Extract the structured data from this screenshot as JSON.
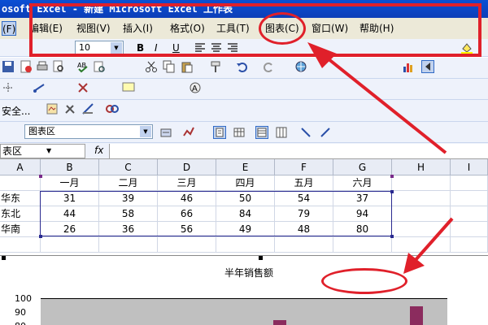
{
  "window": {
    "title": "osoft Excel - 新建 Microsoft Excel 工作表"
  },
  "menu": {
    "items": [
      {
        "label": "(F)",
        "name": "menu-file"
      },
      {
        "label": "编辑(E)",
        "name": "menu-edit"
      },
      {
        "label": "视图(V)",
        "name": "menu-view"
      },
      {
        "label": "插入(I)",
        "name": "menu-insert"
      },
      {
        "label": "格式(O)",
        "name": "menu-format"
      },
      {
        "label": "工具(T)",
        "name": "menu-tools"
      },
      {
        "label": "图表(C)",
        "name": "menu-chart"
      },
      {
        "label": "窗口(W)",
        "name": "menu-window"
      },
      {
        "label": "帮助(H)",
        "name": "menu-help"
      }
    ]
  },
  "toolbar": {
    "font_size": "10",
    "security_label": "安全...",
    "chart_object": "图表区"
  },
  "formula_bar": {
    "name_box": "表区",
    "fx": "fx"
  },
  "sheet": {
    "columns": [
      "A",
      "B",
      "C",
      "D",
      "E",
      "F",
      "G",
      "H",
      "I"
    ],
    "rows": [
      [
        "",
        "一月",
        "二月",
        "三月",
        "四月",
        "五月",
        "六月",
        "",
        ""
      ],
      [
        "华东",
        "31",
        "39",
        "46",
        "50",
        "54",
        "37",
        "",
        ""
      ],
      [
        "东北",
        "44",
        "58",
        "66",
        "84",
        "79",
        "94",
        "",
        ""
      ],
      [
        "华南",
        "26",
        "36",
        "56",
        "49",
        "48",
        "80",
        "",
        ""
      ],
      [
        "",
        "",
        "",
        "",
        "",
        "",
        "",
        "",
        ""
      ]
    ]
  },
  "chart": {
    "title": "半年销售额",
    "y_ticks": [
      "100",
      "90",
      "80"
    ]
  },
  "colors": {
    "annotation": "#e0202a",
    "accent": "#316ac5",
    "bar": "#8b2c5e"
  },
  "chart_data": {
    "type": "bar",
    "title": "半年销售额",
    "categories": [
      "一月",
      "二月",
      "三月",
      "四月",
      "五月",
      "六月"
    ],
    "series": [
      {
        "name": "华东",
        "values": [
          31,
          39,
          46,
          50,
          54,
          37
        ]
      },
      {
        "name": "东北",
        "values": [
          44,
          58,
          66,
          84,
          79,
          94
        ]
      },
      {
        "name": "华南",
        "values": [
          26,
          36,
          56,
          49,
          48,
          80
        ]
      }
    ],
    "ylim": [
      0,
      100
    ]
  }
}
